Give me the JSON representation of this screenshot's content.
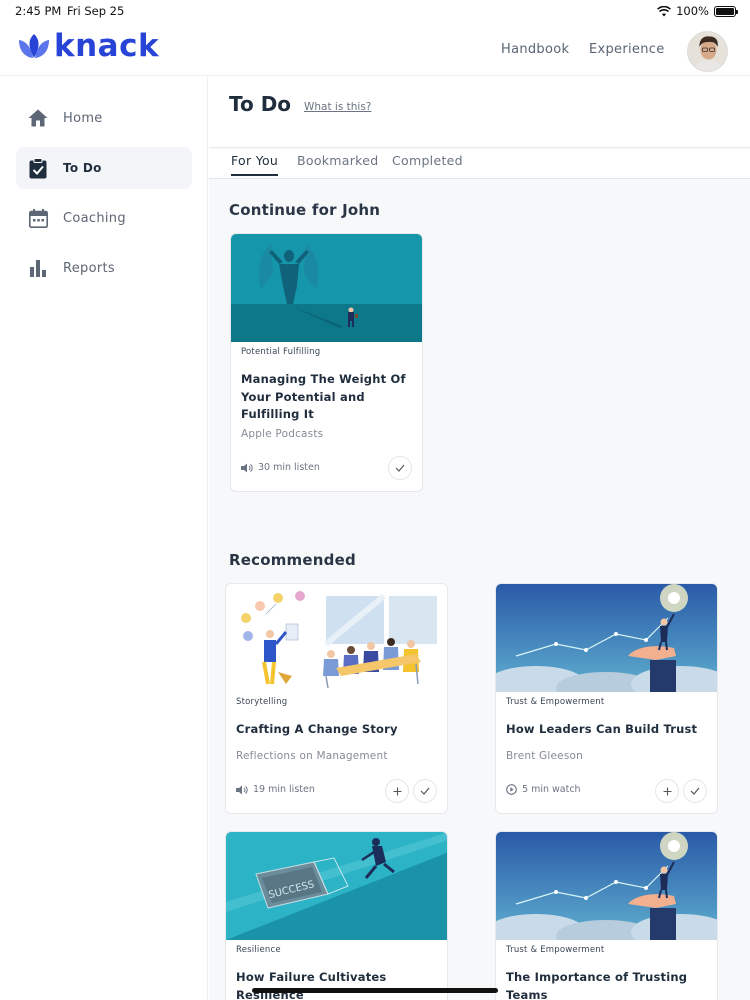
{
  "status": {
    "time": "2:45 PM",
    "date": "Fri Sep 25",
    "battery": "100%"
  },
  "brand": {
    "name": "knack",
    "color": "#2744d6"
  },
  "topnav": {
    "handbook": "Handbook",
    "experience": "Experience"
  },
  "sidebar": {
    "items": [
      {
        "label": "Home",
        "icon": "home-icon",
        "active": false
      },
      {
        "label": "To Do",
        "icon": "clipboard-check-icon",
        "active": true
      },
      {
        "label": "Coaching",
        "icon": "calendar-icon",
        "active": false
      },
      {
        "label": "Reports",
        "icon": "bar-chart-icon",
        "active": false
      }
    ]
  },
  "page": {
    "title": "To Do",
    "what_is_this": "What is this?"
  },
  "tabs": [
    "For You",
    "Bookmarked",
    "Completed"
  ],
  "continue": {
    "title": "Continue for John",
    "card": {
      "category": "Potential Fulfilling",
      "title": "Managing The Weight Of Your Potential and Fulfilling It",
      "source": "Apple Podcasts",
      "meta": "30 min listen",
      "meta_icon": "speaker-icon"
    }
  },
  "recommended": {
    "title": "Recommended",
    "cards": [
      {
        "category": "Storytelling",
        "title": "Crafting A Change Story",
        "source": "Reflections on Management",
        "meta": "19 min listen",
        "meta_icon": "speaker-icon"
      },
      {
        "category": "Trust & Empowerment",
        "title": "How Leaders Can Build Trust",
        "source": "Brent Gleeson",
        "meta": "5 min watch",
        "meta_icon": "play-circle-icon"
      },
      {
        "category": "Resilience",
        "title": "How Failure Cultivates Resilience",
        "image_text": "SUCCESS"
      },
      {
        "category": "Trust & Empowerment",
        "title": "The Importance of Trusting Teams"
      }
    ]
  }
}
